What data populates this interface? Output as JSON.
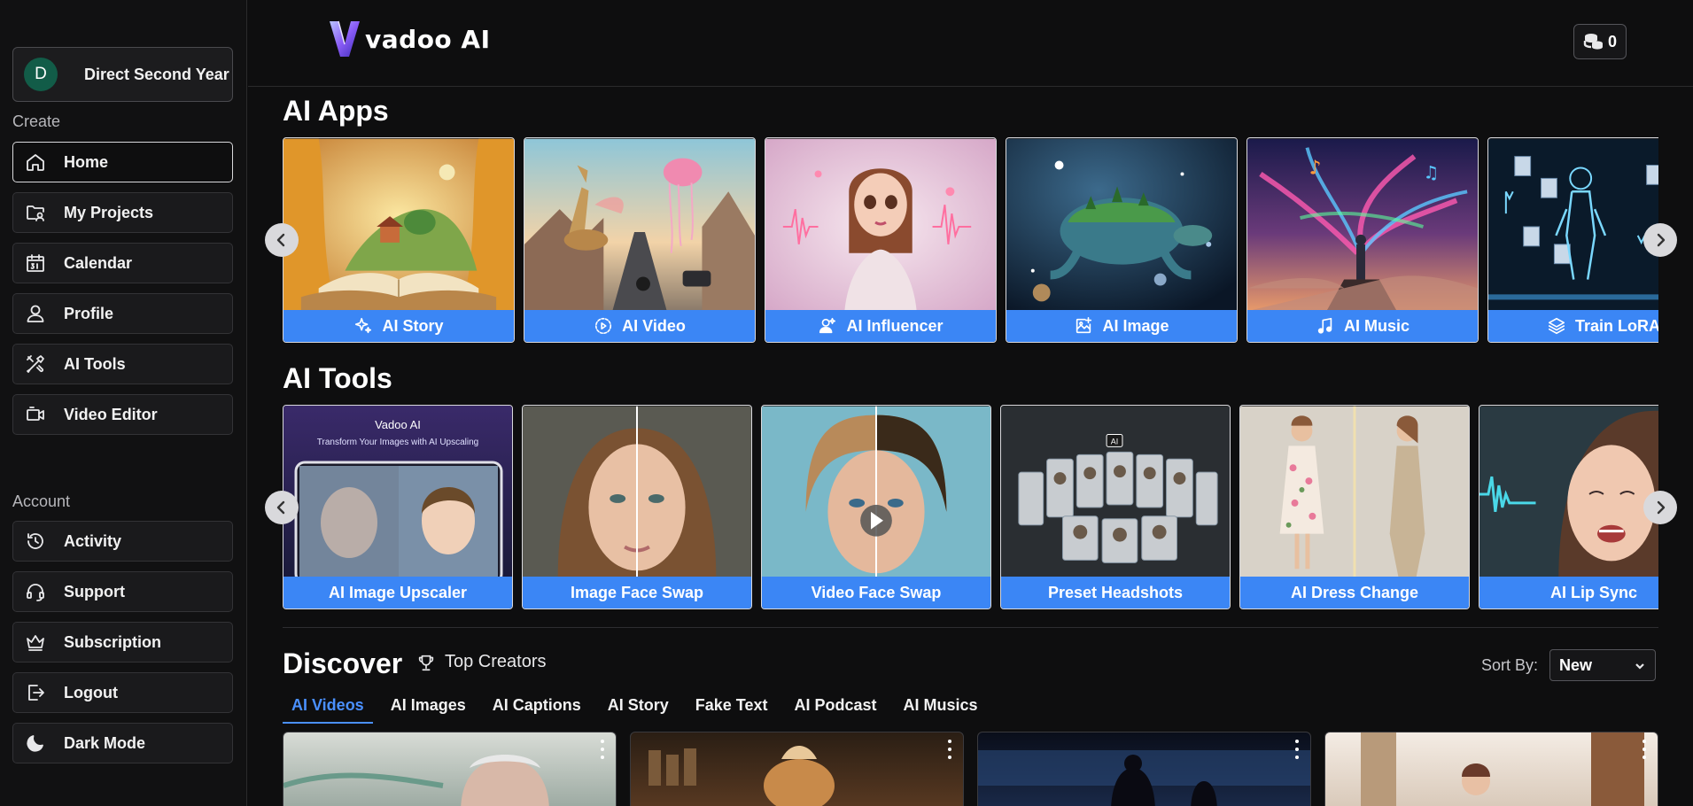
{
  "user": {
    "initial": "D",
    "name": "Direct Second Year"
  },
  "sidebar": {
    "create_label": "Create",
    "create_items": [
      {
        "label": "Home",
        "icon": "home-icon"
      },
      {
        "label": "My Projects",
        "icon": "folder-user-icon"
      },
      {
        "label": "Calendar",
        "icon": "calendar-icon"
      },
      {
        "label": "Profile",
        "icon": "user-icon"
      },
      {
        "label": "AI Tools",
        "icon": "tools-icon"
      },
      {
        "label": "Video Editor",
        "icon": "video-edit-icon"
      }
    ],
    "account_label": "Account",
    "account_items": [
      {
        "label": "Activity",
        "icon": "history-icon"
      },
      {
        "label": "Support",
        "icon": "headset-icon"
      },
      {
        "label": "Subscription",
        "icon": "crown-icon"
      },
      {
        "label": "Logout",
        "icon": "logout-icon"
      },
      {
        "label": "Dark Mode",
        "icon": "moon-icon"
      }
    ]
  },
  "header": {
    "logo_text": "vadoo AI",
    "credits": "0"
  },
  "ai_apps": {
    "title": "AI Apps",
    "cards": [
      {
        "label": "AI Story",
        "icon": "sparkles-icon"
      },
      {
        "label": "AI Video",
        "icon": "play-circle-icon"
      },
      {
        "label": "AI Influencer",
        "icon": "user-sparkle-icon"
      },
      {
        "label": "AI Image",
        "icon": "image-plus-icon"
      },
      {
        "label": "AI Music",
        "icon": "music-note-icon"
      },
      {
        "label": "Train LoRA",
        "icon": "layers-icon"
      }
    ]
  },
  "ai_tools": {
    "title": "AI Tools",
    "cards": [
      {
        "label": "AI Image Upscaler",
        "promo_brand": "Vadoo AI",
        "promo_tagline": "Transform Your Images with AI Upscaling"
      },
      {
        "label": "Image Face Swap"
      },
      {
        "label": "Video Face Swap"
      },
      {
        "label": "Preset Headshots",
        "badge": "AI"
      },
      {
        "label": "AI Dress Change"
      },
      {
        "label": "AI Lip Sync"
      }
    ]
  },
  "discover": {
    "title": "Discover",
    "top_creators": "Top Creators",
    "sort_label": "Sort By:",
    "sort_value": "New",
    "tabs": [
      "AI Videos",
      "AI Images",
      "AI Captions",
      "AI Story",
      "Fake Text",
      "AI Podcast",
      "AI Musics"
    ],
    "active_tab": "AI Videos"
  },
  "colors": {
    "accent": "#3b86f5",
    "active_tab": "#4a90ff",
    "background": "#0e0e0f"
  }
}
